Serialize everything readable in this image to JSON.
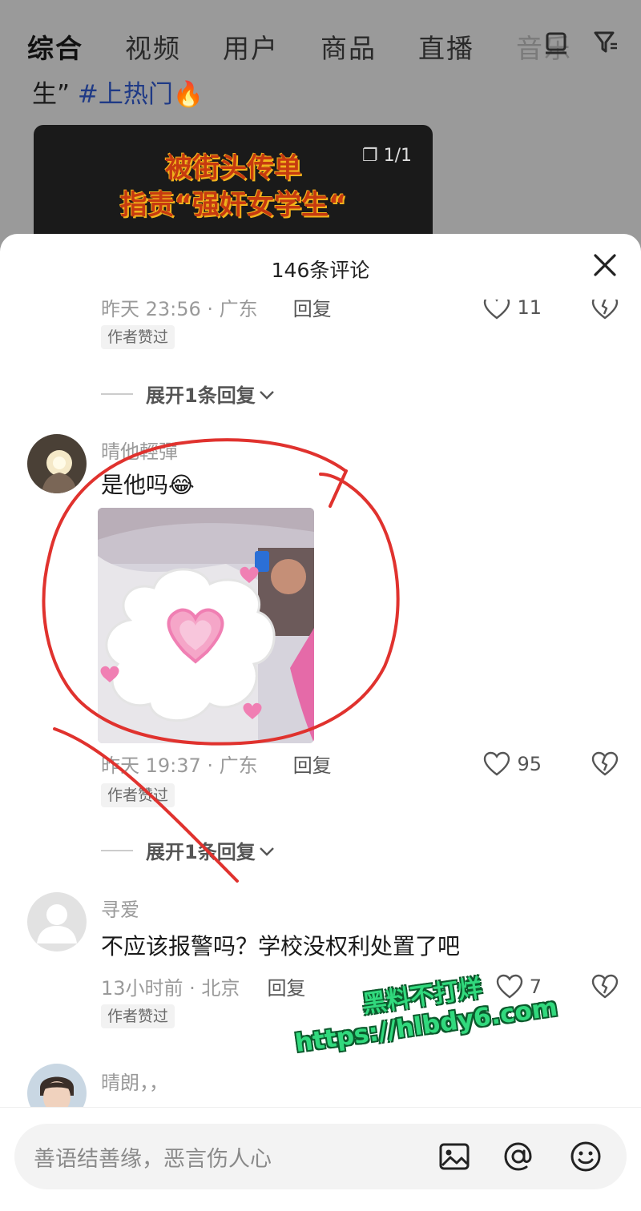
{
  "search_tabs": [
    {
      "label": "综合"
    },
    {
      "label": "视频"
    },
    {
      "label": "用户"
    },
    {
      "label": "商品"
    },
    {
      "label": "直播"
    },
    {
      "label": "音乐"
    }
  ],
  "background_post": {
    "caption_prefix": "生”",
    "caption_tag": "#上热门",
    "thumb_line1": "被街头传单",
    "thumb_line2": "指责“强奸女学生“",
    "thumb_count": "1/1"
  },
  "comments_header": {
    "title": "146条评论"
  },
  "comments": [
    {
      "meta_time": "昨天 23:56 · 广东",
      "reply_label": "回复",
      "likes": "11",
      "author_badge": "作者赞过",
      "expand_label": "展开1条回复"
    },
    {
      "username": "晴他輕彈",
      "text": "是他吗😂",
      "meta_time": "昨天 19:37 · 广东",
      "reply_label": "回复",
      "likes": "95",
      "author_badge": "作者赞过",
      "expand_label": "展开1条回复"
    },
    {
      "username": "寻爱",
      "text": "不应该报警吗？学校没权利处置了吧",
      "meta_time": "13小时前 · 北京",
      "reply_label": "回复",
      "likes": "7",
      "author_badge": "作者赞过"
    },
    {
      "username": "晴朗，，"
    }
  ],
  "watermark": {
    "line1": "黑料不打烊",
    "line2": "https://hlbdy6.com"
  },
  "input": {
    "placeholder": "善语结善缘，恶言伤人心"
  },
  "colors": {
    "annotation_red": "#e0322e",
    "watermark_green": "#31d97d"
  }
}
